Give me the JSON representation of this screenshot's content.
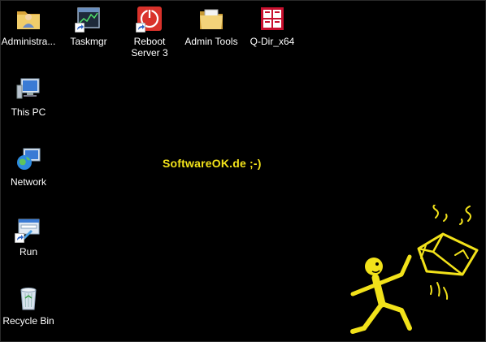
{
  "desktop": {
    "icons": [
      {
        "label": "Administra...",
        "icon": "user-folder-icon"
      },
      {
        "label": "Taskmgr",
        "icon": "task-manager-shortcut-icon"
      },
      {
        "label": "Reboot\nServer 3",
        "icon": "power-restart-shortcut-icon"
      },
      {
        "label": "Admin Tools",
        "icon": "folder-icon"
      },
      {
        "label": "Q-Dir_x64",
        "icon": "q-dir-app-icon"
      },
      {
        "label": "This PC",
        "icon": "computer-icon"
      },
      {
        "label": "Network",
        "icon": "network-globe-icon"
      },
      {
        "label": "Run",
        "icon": "run-shortcut-icon"
      },
      {
        "label": "Recycle Bin",
        "icon": "recycle-bin-icon"
      }
    ]
  },
  "wallpaper": {
    "text": "SoftwareOK.de ;-)",
    "accent_color": "#f2e21a",
    "graphic": "stick-figure-kicking-box"
  }
}
